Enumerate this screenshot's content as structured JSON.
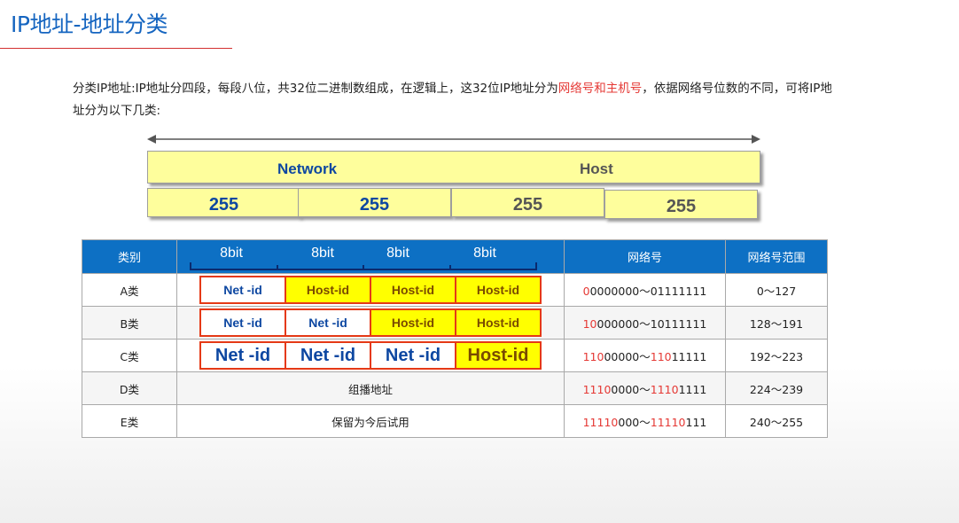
{
  "page": {
    "title": "IP地址-地址分类"
  },
  "intro": {
    "text1": "分类IP地址:IP地址分四段，每段八位，共32位二进制数组成，在逻辑上，这32位IP地址分为",
    "highlight": "网络号和主机号",
    "text2": "，依据网络号位数的不同，可将IP地址分为以下几类:"
  },
  "diagram": {
    "network_label": "Network",
    "host_label": "Host",
    "octets": [
      "255",
      "255",
      "255",
      "255"
    ],
    "colors": {
      "network_text": "#0d47a1",
      "host_text": "#555555",
      "bar_fill": "#fefe9c"
    }
  },
  "table": {
    "headers": {
      "class": "类别",
      "bits": [
        "8bit",
        "8bit",
        "8bit",
        "8bit"
      ],
      "network": "网络号",
      "range": "网络号范围"
    },
    "rows": [
      {
        "class": "A类",
        "cells": [
          "Net -id",
          "Host-id",
          "Host-id",
          "Host-id"
        ],
        "bin_red": "0",
        "bin_rest1": "0000000",
        "sep": "～",
        "bin_red2": "",
        "bin_rest2": "01111111",
        "range": "0～127"
      },
      {
        "class": "B类",
        "cells": [
          "Net -id",
          "Net -id",
          "Host-id",
          "Host-id"
        ],
        "bin_red": "10",
        "bin_rest1": "000000",
        "sep": "～",
        "bin_red2": "",
        "bin_rest2": "10111111",
        "range": "128～191"
      },
      {
        "class": "C类",
        "cells": [
          "Net -id",
          "Net -id",
          "Net -id",
          "Host-id"
        ],
        "bin_red": "110",
        "bin_rest1": "00000",
        "sep": "～",
        "bin_red2": "110",
        "bin_rest2": "11111",
        "range": "192～223"
      },
      {
        "class": "D类",
        "span": "组播地址",
        "bin_red": "1110",
        "bin_rest1": "0000",
        "sep": "～",
        "bin_red2": "1110",
        "bin_rest2": "1111",
        "range": "224～239"
      },
      {
        "class": "E类",
        "span": "保留为今后试用",
        "bin_red": "11110",
        "bin_rest1": "000",
        "sep": "～",
        "bin_red2": "11110",
        "bin_rest2": "111",
        "range": "240～255"
      }
    ],
    "colors": {
      "header_bg": "#0d70c4",
      "cell_border": "#e53916",
      "host_fill": "#ffff00",
      "net_text": "#0d47a1",
      "binary_red": "#e53935"
    }
  }
}
